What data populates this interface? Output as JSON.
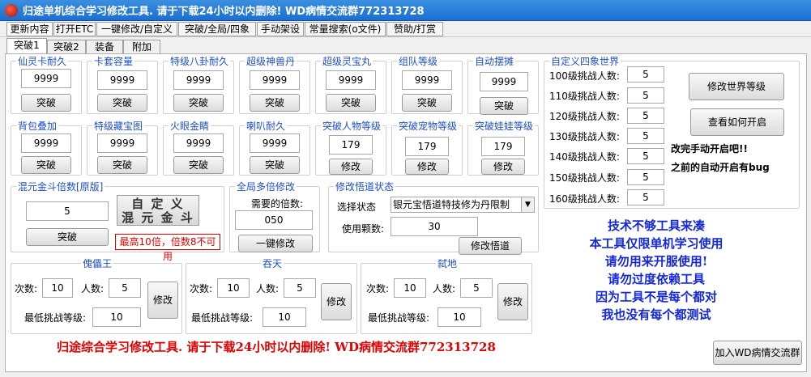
{
  "window": {
    "title": "归途单机综合学习修改工具. 请于下载24小时以内删除!  WD病情交流群772313728"
  },
  "menu_tabs": [
    "更新内容",
    "打开ETC",
    "一键修改/自定义",
    "突破/全局/四象",
    "手动架设",
    "常量搜索(o文件)",
    "赞助/打赏"
  ],
  "sub_tabs": [
    "突破1",
    "突破2",
    "装备",
    "附加"
  ],
  "top_groups": [
    {
      "label": "仙灵卡耐久",
      "value": "9999",
      "button": "突破"
    },
    {
      "label": "卡套容量",
      "value": "9999",
      "button": "突破"
    },
    {
      "label": "特级八卦耐久",
      "value": "9999",
      "button": "突破"
    },
    {
      "label": "超级神兽丹",
      "value": "9999",
      "button": "突破"
    },
    {
      "label": "超级灵宝丸",
      "value": "9999",
      "button": "突破"
    },
    {
      "label": "组队等级",
      "value": "9999",
      "button": "突破"
    },
    {
      "label": "自动摆摊",
      "value": "9999",
      "button": "突破"
    }
  ],
  "mid_groups": [
    {
      "label": "背包叠加",
      "value": "9999",
      "button": "突破"
    },
    {
      "label": "特级藏宝图",
      "value": "9999",
      "button": "突破"
    },
    {
      "label": "火眼金睛",
      "value": "9999",
      "button": "突破"
    },
    {
      "label": "喇叭耐久",
      "value": "9999",
      "button": "突破"
    },
    {
      "label": "突破人物等级",
      "value": "179",
      "button": "修改"
    },
    {
      "label": "突破宠物等级",
      "value": "179",
      "button": "修改"
    },
    {
      "label": "突破娃娃等级",
      "value": "179",
      "button": "修改"
    }
  ],
  "hunyuan": {
    "label": "混元金斗倍数[原版]",
    "value": "5",
    "button": "突破",
    "custom_line1": "自 定 义",
    "custom_line2": "混 元 金 斗",
    "hint": "最高10倍，倍数8不可用"
  },
  "global": {
    "label": "全局多倍修改",
    "need_label": "需要的倍数:",
    "value": "050",
    "button": "一键修改"
  },
  "wudao": {
    "label": "修改悟道状态",
    "select_label": "选择状态",
    "select_value": "银元宝悟道特技修为丹限制",
    "use_label": "使用颗数:",
    "use_value": "30",
    "button": "修改悟道"
  },
  "world": {
    "label": "自定义四象世界",
    "rows": [
      {
        "label": "100级挑战人数:",
        "value": "5"
      },
      {
        "label": "110级挑战人数:",
        "value": "5"
      },
      {
        "label": "120级挑战人数:",
        "value": "5"
      },
      {
        "label": "130级挑战人数:",
        "value": "5"
      },
      {
        "label": "140级挑战人数:",
        "value": "5"
      },
      {
        "label": "150级挑战人数:",
        "value": "5"
      },
      {
        "label": "160级挑战人数:",
        "value": "5"
      }
    ],
    "btn_modify": "修改世界等级",
    "btn_view": "查看如何开启",
    "note1": "改完手动开启吧!!",
    "note2": "之前的自动开启有bug"
  },
  "bosses": [
    {
      "label": "傀儡王",
      "times_label": "次数:",
      "times": "10",
      "people_label": "人数:",
      "people": "5",
      "min_label": "最低挑战等级:",
      "min": "10",
      "button": "修改"
    },
    {
      "label": "吞天",
      "times_label": "次数:",
      "times": "10",
      "people_label": "人数:",
      "people": "5",
      "min_label": "最低挑战等级:",
      "min": "10",
      "button": "修改"
    },
    {
      "label": "弑地",
      "times_label": "次数:",
      "times": "10",
      "people_label": "人数:",
      "people": "5",
      "min_label": "最低挑战等级:",
      "min": "10",
      "button": "修改"
    }
  ],
  "notice": [
    "技术不够工具来凑",
    "本工具仅限单机学习使用",
    "请勿用来开服使用!",
    "请勿过度依赖工具",
    "因为工具不是每个都对",
    "我也没有每个都测试"
  ],
  "bottom_text": "归途综合学习修改工具. 请于下载24小时以内删除!  WD病情交流群772313728",
  "join_button": "加入WD病情交流群",
  "colors": {
    "title_bg": "#1c6fd0",
    "label_blue": "#1e50c8",
    "warn_red": "#e00000",
    "notice_blue": "#1428d8"
  }
}
